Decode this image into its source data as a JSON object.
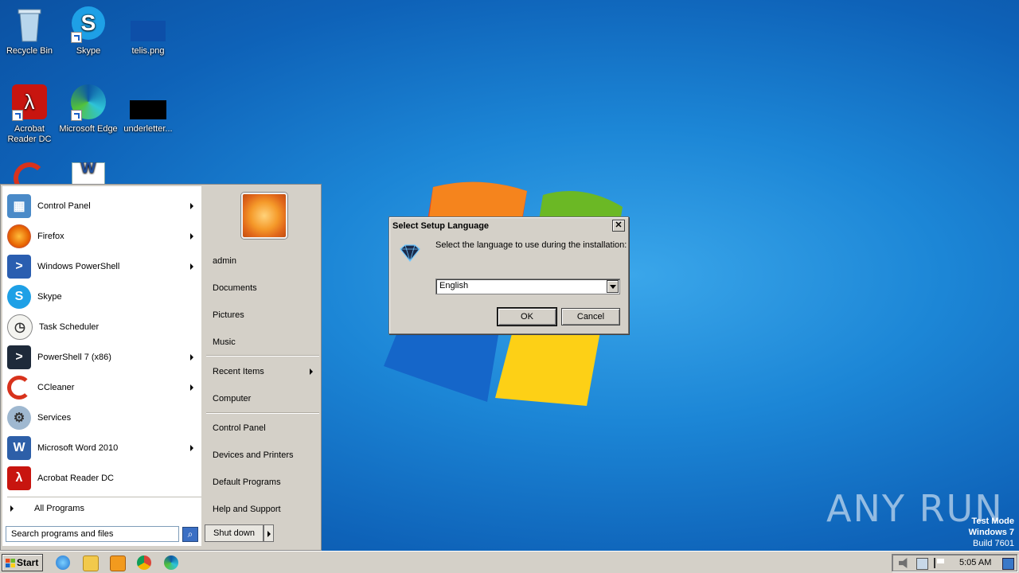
{
  "desktop": {
    "icons": [
      {
        "label": "Recycle Bin"
      },
      {
        "label": "Skype"
      },
      {
        "label": "telis.png"
      },
      {
        "label": "Acrobat Reader DC"
      },
      {
        "label": "Microsoft Edge"
      },
      {
        "label": "underletter..."
      }
    ]
  },
  "start_menu": {
    "programs": [
      {
        "label": "Control Panel",
        "icon": "control-panel-icon"
      },
      {
        "label": "Firefox",
        "icon": "firefox-icon"
      },
      {
        "label": "Windows PowerShell",
        "icon": "powershell-icon"
      },
      {
        "label": "Skype",
        "icon": "skype-icon"
      },
      {
        "label": "Task Scheduler",
        "icon": "task-scheduler-icon"
      },
      {
        "label": "PowerShell 7 (x86)",
        "icon": "powershell7-icon"
      },
      {
        "label": "CCleaner",
        "icon": "ccleaner-icon"
      },
      {
        "label": "Services",
        "icon": "services-icon"
      },
      {
        "label": "Microsoft Word 2010",
        "icon": "word-icon"
      },
      {
        "label": "Acrobat Reader DC",
        "icon": "acrobat-icon"
      }
    ],
    "all_programs": "All Programs",
    "search_placeholder": "Search programs and files",
    "right": [
      "admin",
      "Documents",
      "Pictures",
      "Music",
      "Recent Items",
      "Computer",
      "Control Panel",
      "Devices and Printers",
      "Default Programs",
      "Help and Support"
    ],
    "shutdown": "Shut down"
  },
  "dialog": {
    "title": "Select Setup Language",
    "message": "Select the language to use during the installation:",
    "selected_language": "English",
    "ok": "OK",
    "cancel": "Cancel"
  },
  "taskbar": {
    "start": "Start",
    "clock": "5:05 AM"
  },
  "watermark": {
    "brand": "ANY RUN",
    "mode": "Test Mode",
    "os": "Windows 7",
    "build": "Build 7601"
  }
}
